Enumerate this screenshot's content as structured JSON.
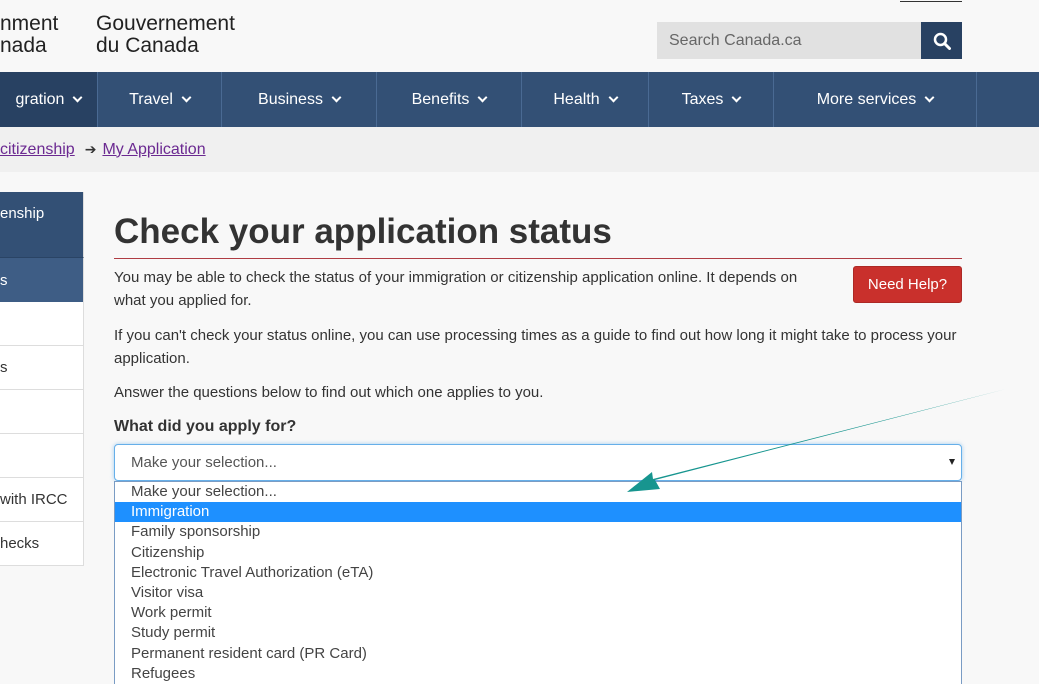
{
  "header": {
    "brand_en_line1": "nment",
    "brand_en_line2": "nada",
    "brand_fr_line1": "Gouvernement",
    "brand_fr_line2": "du Canada",
    "search_placeholder": "Search Canada.ca"
  },
  "nav": {
    "items": [
      {
        "label": "gration"
      },
      {
        "label": "Travel"
      },
      {
        "label": "Business"
      },
      {
        "label": "Benefits"
      },
      {
        "label": "Health"
      },
      {
        "label": "Taxes"
      },
      {
        "label": "More services"
      }
    ]
  },
  "breadcrumb": {
    "items": [
      {
        "label": "citizenship"
      },
      {
        "label": "My Application"
      }
    ]
  },
  "sidebar": {
    "items": [
      {
        "label": "enship"
      },
      {
        "label": "s"
      },
      {
        "label": ""
      },
      {
        "label": "s"
      },
      {
        "label": ""
      },
      {
        "label": ""
      },
      {
        "label": "with IRCC"
      },
      {
        "label": "hecks"
      }
    ]
  },
  "main": {
    "title": "Check your application status",
    "help_label": "Need Help?",
    "para1": "You may be able to check the status of your immigration or citizenship application online. It depends on what you applied for.",
    "para2": "If you can't check your status online, you can use processing times as a guide to find out how long it might take to process your application.",
    "para3": "Answer the questions below to find out which one applies to you.",
    "question": "What did you apply for?",
    "select_value": "Make your selection...",
    "options": [
      "Make your selection...",
      "Immigration",
      "Family sponsorship",
      "Citizenship",
      "Electronic Travel Authorization (eTA)",
      "Visitor visa",
      "Work permit",
      "Study permit",
      "Permanent resident card (PR Card)",
      "Refugees"
    ],
    "highlighted_option_index": 1
  },
  "colors": {
    "nav_bg": "#335075",
    "highlight": "#1e90ff",
    "annotation_arrow": "#17958f",
    "help_button": "#c9302c"
  }
}
